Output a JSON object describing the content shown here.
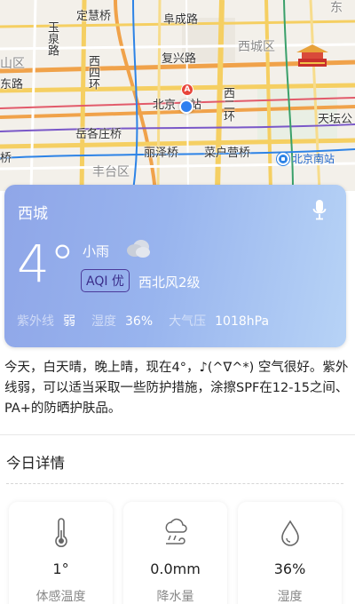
{
  "map": {
    "labels": {
      "dingdu_qiao": "定慧桥",
      "fucheng_lu": "阜成路",
      "dong": "东",
      "yuquan_lu": "玉泉路",
      "xisihuan": "西四环",
      "xicheng_qu": "西城区",
      "shan_qu": "山区",
      "fuxing_lu": "复兴路",
      "dong_lu": "东路",
      "beijing_station_label": "北京",
      "zhan": "站",
      "xierhuan": "西二环",
      "tianqiao": "天坛公",
      "yuegezhuang_qiao": "岳各庄桥",
      "lize_qiao": "丽泽桥",
      "caihuying_qiao": "菜户营桥",
      "qiao": "桥",
      "fengtai_qu": "丰台区",
      "beijing_south": "北京南站"
    },
    "pin_label": "A",
    "landmark_icon": "gate-icon"
  },
  "weather": {
    "city": "西城",
    "temperature": "4°",
    "condition": "小雨",
    "condition_icon": "cloud-icon",
    "aqi": "AQI 优",
    "wind": "西北风2级",
    "uv_label": "紫外线",
    "uv_value": "弱",
    "humidity_label": "湿度",
    "humidity_value": "36%",
    "pressure_label": "大气压",
    "pressure_value": "1018hPa",
    "mic_icon": "microphone-icon"
  },
  "summary": "今天，白天晴，晚上晴，现在4°，♪(^∇^*) 空气很好。紫外线弱，可以适当采取一些防护措施，涂擦SPF在12-15之间、PA+的防晒护肤品。",
  "details": {
    "title": "今日详情",
    "tiles": [
      {
        "icon": "thermometer-icon",
        "value": "1°",
        "label": "体感温度"
      },
      {
        "icon": "rain-wind-icon",
        "value": "0.0mm",
        "label": "降水量"
      },
      {
        "icon": "water-drop-icon",
        "value": "36%",
        "label": "湿度"
      }
    ]
  },
  "colors": {
    "card_gradient_start": "#8fa6e8",
    "card_gradient_end": "#b7d3f6",
    "aqi_border": "#4b3a9a",
    "road_yellow": "#f5cf62",
    "road_orange": "#f0a24a",
    "metro_blue": "#2d83e6"
  }
}
